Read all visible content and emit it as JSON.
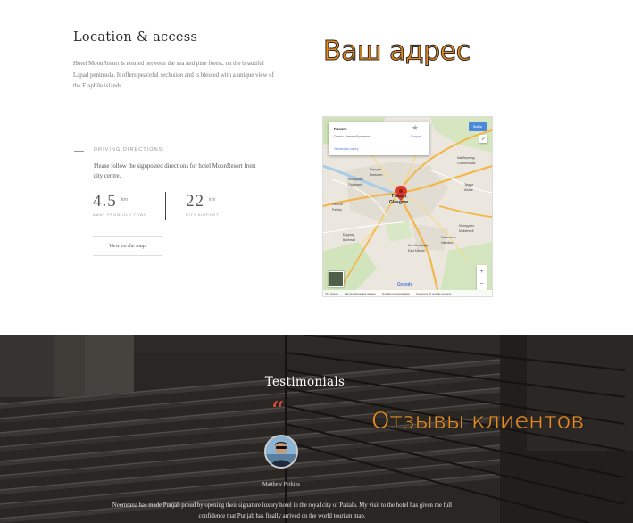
{
  "location": {
    "title": "Location & access",
    "description": "Hotel MoonResort is nestled between the sea and pine forest, on the beautiful Lapad peninsula. It offers peaceful seclusion and is blessed with a unique view of the Elaphile islands."
  },
  "annotations": {
    "address": "Ваш адрес",
    "reviews": "Отзывы клиентов"
  },
  "directions": {
    "label": "DRIVING DIRECTIONS:",
    "text": "Please follow the signposted directions for hotel MoonResort from city centre.",
    "stats": [
      {
        "value": "4.5",
        "unit": "km",
        "caption": "away from old town"
      },
      {
        "value": "22",
        "unit": "km",
        "caption": "city airport"
      }
    ],
    "map_link": "View on the map"
  },
  "map": {
    "card_title": "Глазго",
    "card_subtitle": "Глазго, Великобритания",
    "card_save": "Сохран...",
    "card_link": "Увеличить карту",
    "route_button": "Войти",
    "zoom_in": "+",
    "zoom_out": "−",
    "google": "Google",
    "footer": [
      "©16 Google",
      "Картографические данные",
      "Условия использования",
      "Сообщить об ошибке на карте"
    ],
    "cities": {
      "glasgow": "Глазго",
      "glasgow_en": "Glasgow",
      "paisley": "Пейсли",
      "paisley_en": "Paisley",
      "kilbride": "Ист-Килбрайд",
      "kilbride_en": "East Kilbride",
      "hamilton": "Гамильтон",
      "hamilton_en": "Hamilton",
      "cumbernauld": "Камбернолд",
      "cumbernauld_en": "Cumbernauld",
      "airdrie": "Эрдри",
      "airdrie_en": "Airdrie",
      "bearsden": "Берсден",
      "bearsden_en": "Bearsden",
      "clydebank": "Клайдбанк",
      "clydebank_en": "Clydebank",
      "barrhead": "Баррхед",
      "barrhead_en": "Barrhead",
      "motherwell": "Мотеруэлл",
      "motherwell_en": "Motherwell"
    }
  },
  "testimonials": {
    "title": "Testimonials",
    "quote_mark": "“",
    "person": "Matthew Perkins",
    "text": "Neemrana has made Punjab proud by opening their signature luxury hotel in the royal city of Patiala. My visit to the hotel has given me full confidence that Punjab has finally arrived on the world tourism map."
  },
  "colors": {
    "annotation": "#e98a1c",
    "quote": "#e04a3a",
    "pin": "#d93a2a"
  }
}
